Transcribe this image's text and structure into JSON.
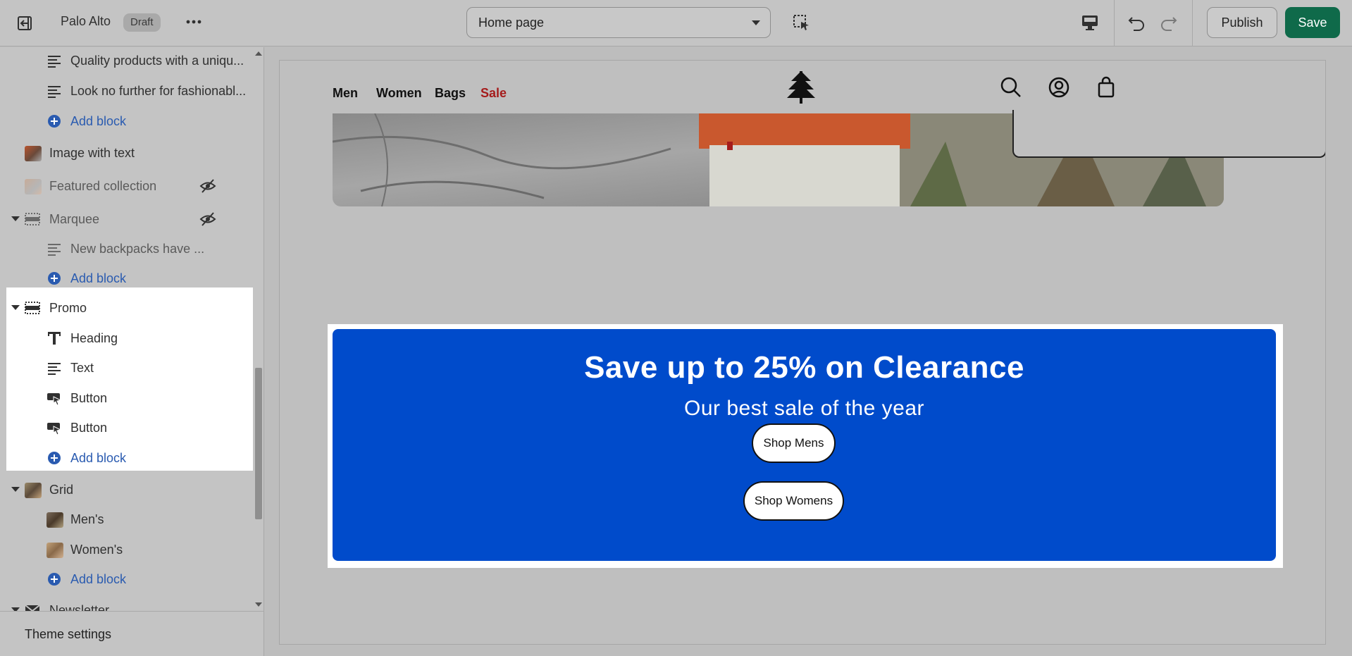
{
  "topbar": {
    "store_name": "Palo Alto",
    "status_badge": "Draft",
    "page_select": "Home page",
    "publish_label": "Publish",
    "save_label": "Save",
    "save_color": "#0f6a4a"
  },
  "sidebar": {
    "rows": [
      {
        "label": "Quality products with a uniqu...",
        "icon": "text-lines-icon"
      },
      {
        "label": "Look no further for fashionabl...",
        "icon": "text-lines-icon"
      },
      {
        "label": "Add block",
        "icon": "plus-circle-icon"
      },
      {
        "label": "Image with text",
        "icon": "image-thumbnail"
      },
      {
        "label": "Featured collection",
        "icon": "image-thumbnail",
        "hidden": true
      },
      {
        "label": "Marquee",
        "icon": "section-icon",
        "hidden": true
      },
      {
        "label": "New backpacks have ...",
        "icon": "text-lines-icon"
      },
      {
        "label": "Add block",
        "icon": "plus-circle-icon"
      },
      {
        "label": "Promo",
        "icon": "section-icon",
        "selected": true
      },
      {
        "label": "Heading",
        "icon": "heading-T-icon"
      },
      {
        "label": "Text",
        "icon": "text-lines-icon"
      },
      {
        "label": "Button",
        "icon": "button-cursor-icon"
      },
      {
        "label": "Button",
        "icon": "button-cursor-icon"
      },
      {
        "label": "Add block",
        "icon": "plus-circle-icon"
      },
      {
        "label": "Grid",
        "icon": "image-thumbnail"
      },
      {
        "label": "Men's",
        "icon": "image-thumbnail"
      },
      {
        "label": "Women's",
        "icon": "image-thumbnail"
      },
      {
        "label": "Add block",
        "icon": "plus-circle-icon"
      },
      {
        "label": "Newsletter",
        "icon": "mail-icon"
      }
    ],
    "theme_settings": "Theme settings"
  },
  "preview": {
    "nav": [
      "Men",
      "Women",
      "Bags",
      "Sale"
    ],
    "sale_color": "#a51c1c",
    "promo": {
      "heading": "Save up to 25% on Clearance",
      "subheading": "Our best sale of the year",
      "button_1": "Shop Mens",
      "button_2": "Shop Womens",
      "background": "#004bcb"
    }
  }
}
